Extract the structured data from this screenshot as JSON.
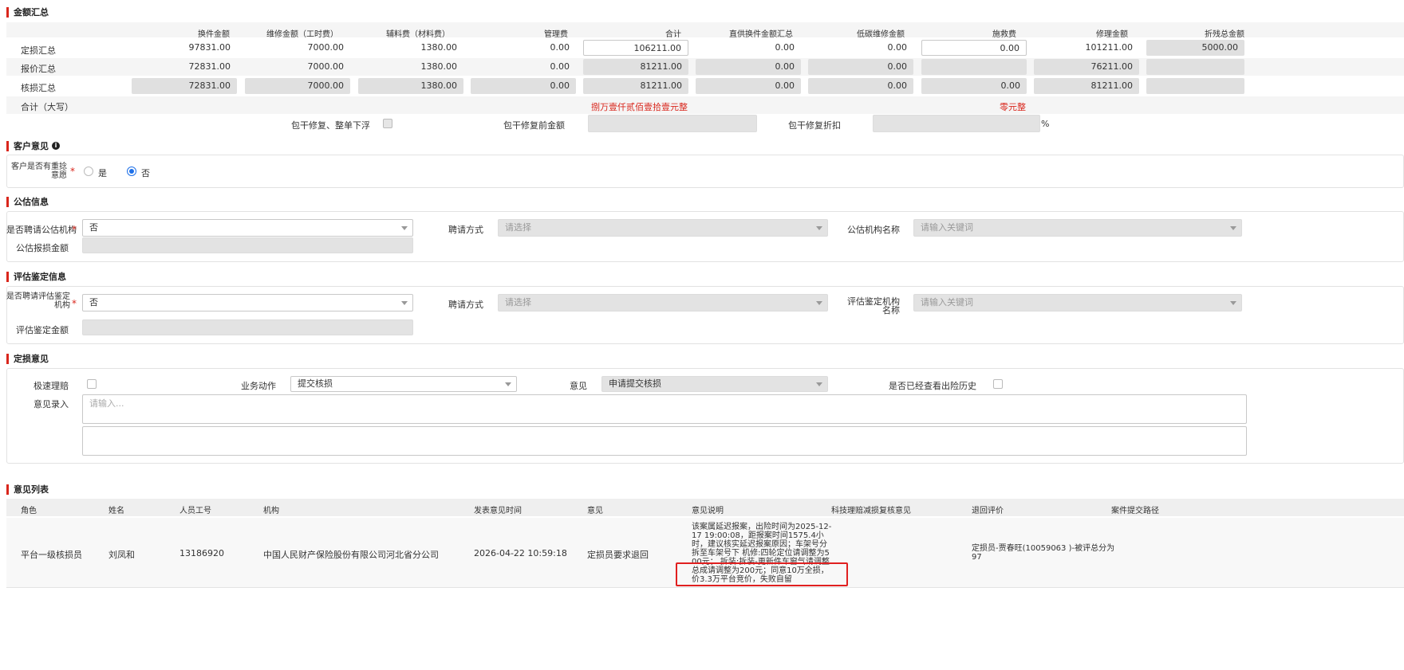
{
  "amount_summary": {
    "title": "金额汇总",
    "headers": [
      "换件金额",
      "维修金额（工时费）",
      "辅料费（材料费）",
      "管理费",
      "合计",
      "直供换件金额汇总",
      "低碳维修金额",
      "施救费",
      "修理金额",
      "折残总金额"
    ],
    "rows": [
      {
        "label": "定损汇总",
        "values": [
          "97831.00",
          "7000.00",
          "1380.00",
          "0.00",
          "106211.00",
          "0.00",
          "0.00",
          "0.00",
          "101211.00",
          "5000.00"
        ]
      },
      {
        "label": "报价汇总",
        "values": [
          "72831.00",
          "7000.00",
          "1380.00",
          "0.00",
          "81211.00",
          "0.00",
          "0.00",
          "",
          "76211.00",
          ""
        ]
      },
      {
        "label": "核损汇总",
        "values": [
          "72831.00",
          "7000.00",
          "1380.00",
          "0.00",
          "81211.00",
          "0.00",
          "0.00",
          "0.00",
          "81211.00",
          ""
        ]
      }
    ],
    "total_label": "合计（大写）",
    "total_upper_1": "捌万壹仟贰佰壹拾壹元整",
    "total_upper_2": "零元整",
    "lump_repair_label": "包干修复、整单下浮",
    "lump_before_label": "包干修复前金额",
    "lump_discount_label": "包干修复折扣",
    "percent": "%"
  },
  "customer_opinion": {
    "title": "客户意见",
    "question": "客户是否有重捻意愿",
    "options": [
      "是",
      "否"
    ],
    "selected": "否"
  },
  "notary": {
    "title": "公估信息",
    "hire_label": "是否聘请公估机构",
    "hire_value": "否",
    "method_label": "聘请方式",
    "method_placeholder": "请选择",
    "org_label": "公估机构名称",
    "org_placeholder": "请输入关键词",
    "amount_label": "公估报损金额"
  },
  "appraisal": {
    "title": "评估鉴定信息",
    "hire_label": "是否聘请评估鉴定机构",
    "hire_value": "否",
    "method_label": "聘请方式",
    "method_placeholder": "请选择",
    "org_label": "评估鉴定机构名称",
    "org_placeholder": "请输入关键词",
    "amount_label": "评估鉴定金额"
  },
  "loss_opinion": {
    "title": "定损意见",
    "fast_label": "极速理赔",
    "action_label": "业务动作",
    "action_value": "提交核损",
    "opinion_label": "意见",
    "opinion_value": "申请提交核损",
    "history_label": "是否已经查看出险历史",
    "entry_label": "意见录入",
    "entry_placeholder": "请输入..."
  },
  "opinion_list": {
    "title": "意见列表",
    "columns": [
      "角色",
      "姓名",
      "人员工号",
      "机构",
      "发表意见时间",
      "意见",
      "意见说明",
      "科技理赔减损复核意见",
      "退回评价",
      "案件提交路径"
    ],
    "rows": [
      {
        "role": "平台一级核损员",
        "name": "刘凤和",
        "staff_id": "13186920",
        "org": "中国人民财产保险股份有限公司河北省分公司",
        "time": "2026-04-22 10:59:18",
        "opinion": "定损员要求退回",
        "desc_lines": [
          "该案属延迟报案，出险时间为2025-12-",
          "17 19:00:08，距报案时间1575.4小",
          "时，建议核实延迟报案原因；车架号分",
          "拆至车架号下 机修:四轮定位请调整为5",
          "00元； 拆装:拆装-更新件车窗气请调整",
          "总成请调整为200元；同意10万全损，",
          "价3.3万平台竞价，失败自留"
        ],
        "return_eval": "定损员-贾春旺(10059063 )-被评总分为97"
      }
    ]
  }
}
